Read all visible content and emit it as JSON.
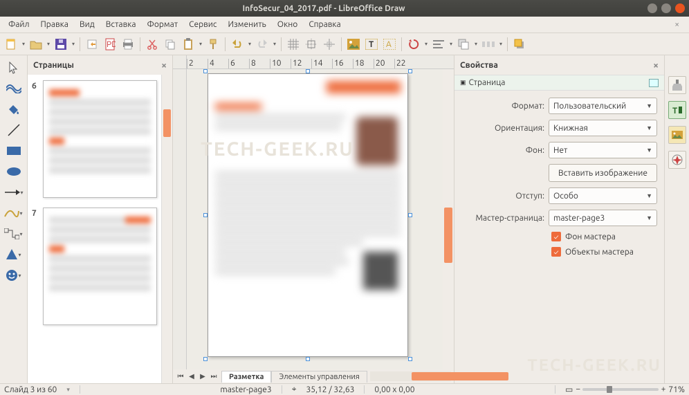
{
  "window": {
    "title": "InfoSecur_04_2017.pdf - LibreOffice Draw"
  },
  "menu": {
    "file": "Файл",
    "edit": "Правка",
    "view": "Вид",
    "insert": "Вставка",
    "format": "Формат",
    "tools": "Сервис",
    "modify": "Изменить",
    "window": "Окно",
    "help": "Справка"
  },
  "pages_panel": {
    "title": "Страницы",
    "p6": "6",
    "p7": "7"
  },
  "ruler": {
    "m2": "2",
    "m4": "4",
    "m6": "6",
    "m8": "8",
    "m10": "10",
    "m12": "12",
    "m14": "14",
    "m16": "16",
    "m18": "18",
    "m20": "20",
    "m22": "22"
  },
  "sheet_tabs": {
    "layout": "Разметка",
    "controls": "Элементы управления"
  },
  "props": {
    "title": "Свойства",
    "section": "Страница",
    "format_label": "Формат:",
    "format_value": "Пользовательский",
    "orient_label": "Ориентация:",
    "orient_value": "Книжная",
    "bg_label": "Фон:",
    "bg_value": "Нет",
    "insert_image": "Вставить изображение",
    "margin_label": "Отступ:",
    "margin_value": "Особо",
    "master_label": "Мастер-страница:",
    "master_value": "master-page3",
    "chk_bg": "Фон мастера",
    "chk_obj": "Объекты мастера"
  },
  "status": {
    "slide": "Слайд 3 из 60",
    "master": "master-page3",
    "pos": "35,12 / 32,63",
    "size": "0,00 x 0,00",
    "zoom": "71%"
  }
}
